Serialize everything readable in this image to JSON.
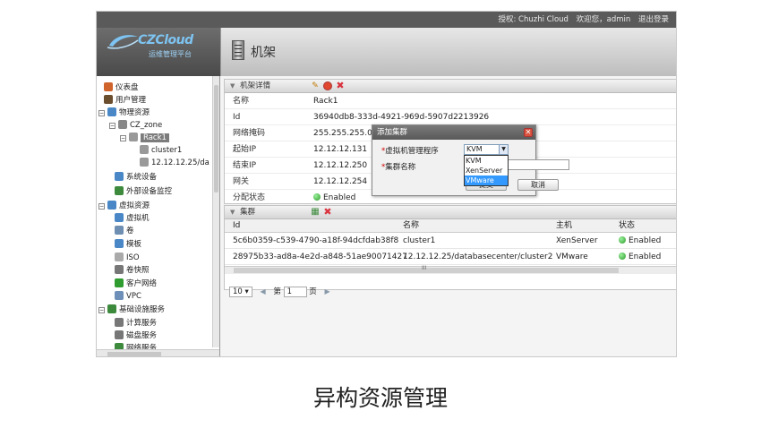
{
  "topbar": {
    "org": "授权: Chuzhi Cloud",
    "welcome": "欢迎您，admin",
    "logout": "退出登录"
  },
  "logo": {
    "name": "CZCloud",
    "sub": "运维管理平台"
  },
  "page": {
    "title": "机架"
  },
  "sidebar": {
    "items": [
      {
        "label": "仪表盘",
        "icon": "dashboard-icon",
        "color": "#d0642d"
      },
      {
        "label": "用户管理",
        "icon": "user-icon",
        "color": "#6b4e2e"
      },
      {
        "label": "物理资源",
        "icon": "server-icon",
        "color": "#4a87c6"
      },
      {
        "label": "CZ_zone",
        "icon": "zone-icon",
        "color": "#888888"
      },
      {
        "label": "Rack1",
        "icon": "rack-icon",
        "color": "#999999"
      },
      {
        "label": "cluster1",
        "icon": "cluster-icon",
        "color": "#999999"
      },
      {
        "label": "12.12.12.25/da",
        "icon": "host-icon",
        "color": "#999999"
      },
      {
        "label": "系统设备",
        "icon": "system-device-icon",
        "color": "#4a87c6"
      },
      {
        "label": "外部设备监控",
        "icon": "monitor-icon",
        "color": "#3d8a3d"
      },
      {
        "label": "虚拟资源",
        "icon": "virtual-icon",
        "color": "#4a87c6"
      },
      {
        "label": "虚拟机",
        "icon": "vm-icon",
        "color": "#4a87c6"
      },
      {
        "label": "卷",
        "icon": "volume-icon",
        "color": "#6e8fb2"
      },
      {
        "label": "模板",
        "icon": "template-icon",
        "color": "#4a87c6"
      },
      {
        "label": "ISO",
        "icon": "iso-icon",
        "color": "#aaaaaa"
      },
      {
        "label": "卷快照",
        "icon": "snapshot-icon",
        "color": "#777777"
      },
      {
        "label": "客户网络",
        "icon": "network-icon",
        "color": "#2e9c2e"
      },
      {
        "label": "VPC",
        "icon": "vpc-icon",
        "color": "#6d8fb8"
      },
      {
        "label": "基础设施服务",
        "icon": "infra-icon",
        "color": "#3d8a3d"
      },
      {
        "label": "计算服务",
        "icon": "compute-icon",
        "color": "#777777"
      },
      {
        "label": "磁盘服务",
        "icon": "disk-icon",
        "color": "#777777"
      },
      {
        "label": "网络服务",
        "icon": "net-service-icon",
        "color": "#3d8a3d"
      }
    ],
    "hscroll_text": "III"
  },
  "details": {
    "title": "机架详情",
    "rows": [
      {
        "key": "名称",
        "value": "Rack1"
      },
      {
        "key": "Id",
        "value": "36940db8-333d-4921-969d-5907d2213926"
      },
      {
        "key": "网络掩码",
        "value": "255.255.255.0"
      },
      {
        "key": "起始IP",
        "value": "12.12.12.131"
      },
      {
        "key": "结束IP",
        "value": "12.12.12.250"
      },
      {
        "key": "网关",
        "value": "12.12.12.254"
      },
      {
        "key": "分配状态",
        "value": "Enabled"
      }
    ]
  },
  "clusters": {
    "title": "集群",
    "columns": [
      "Id",
      "名称",
      "主机",
      "状态"
    ],
    "rows": [
      {
        "id": "5c6b0359-c539-4790-a18f-94dcfdab38f8",
        "name": "cluster1",
        "host": "XenServer",
        "status": "Enabled"
      },
      {
        "id": "28975b33-ad8a-4e2d-a848-51ae90071427",
        "name": "12.12.12.25/databasecenter/cluster2",
        "host": "VMware",
        "status": "Enabled"
      }
    ],
    "hscroll_text": "III"
  },
  "pager": {
    "page_size": "10",
    "page_prefix": "第",
    "page_num": "1",
    "page_suffix": "页"
  },
  "dialog": {
    "title": "添加集群",
    "hypervisor_label": "虚拟机管理程序",
    "hypervisor_value": "KVM",
    "options": [
      "KVM",
      "XenServer",
      "VMware"
    ],
    "highlighted_option": "VMware",
    "cluster_name_label": "集群名称",
    "ok_label": "提交",
    "cancel_label": "取消"
  },
  "caption": "异构资源管理",
  "colors": {
    "accent": "#3399ff",
    "enabled": "#2a9a2a",
    "delete": "#d9533f"
  }
}
